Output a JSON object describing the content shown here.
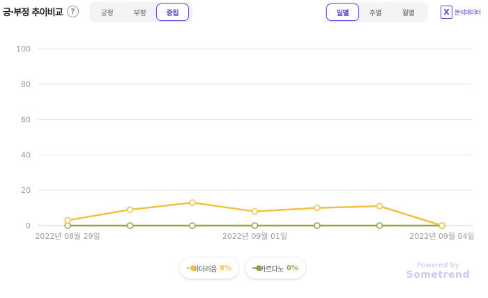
{
  "header": {
    "title": "긍·부정 추이비교",
    "help_icon": "?",
    "sentiment_tabs": [
      {
        "label": "긍정",
        "active": false
      },
      {
        "label": "부정",
        "active": false
      },
      {
        "label": "중립",
        "active": true
      }
    ],
    "period_tabs": [
      {
        "label": "일별",
        "active": true
      },
      {
        "label": "주별",
        "active": false
      },
      {
        "label": "월별",
        "active": false
      }
    ],
    "export": {
      "icon": "excel-icon",
      "icon_glyph": "X",
      "label": "분석데이터"
    }
  },
  "chart_data": {
    "type": "line",
    "x": [
      "2022-08-29",
      "2022-08-30",
      "2022-08-31",
      "2022-09-01",
      "2022-09-02",
      "2022-09-03",
      "2022-09-04"
    ],
    "x_tick_labels": [
      "2022년 08월 29일",
      "2022년 09월 01일",
      "2022년 09월 04일"
    ],
    "y_ticks": [
      0,
      20,
      40,
      60,
      80,
      100
    ],
    "ylim": [
      0,
      100
    ],
    "grid": true,
    "legend_position": "bottom-center",
    "series": [
      {
        "name": "이더리움",
        "percent": "8%",
        "color": "#f0c040",
        "values": [
          3,
          9,
          13,
          8,
          10,
          11,
          0
        ]
      },
      {
        "name": "카르다노",
        "percent": "0%",
        "color": "#8aa83a",
        "values": [
          0,
          0,
          0,
          0,
          0,
          0,
          0
        ]
      }
    ]
  },
  "branding": {
    "powered_by": "Powered by",
    "name": "Sometrend"
  }
}
